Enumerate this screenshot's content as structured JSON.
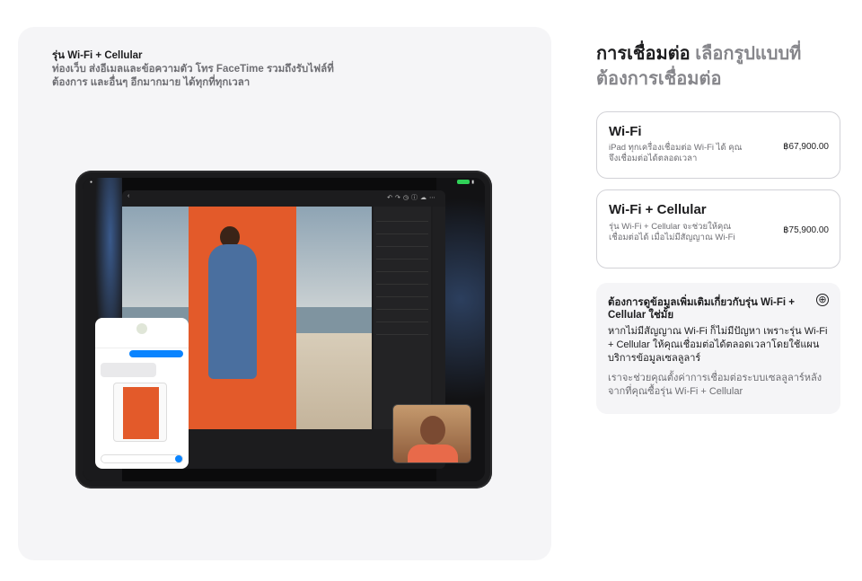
{
  "gallery": {
    "caption_title": "รุ่น Wi-Fi + Cellular",
    "caption_body": "ท่องเว็บ ส่งอีเมลและข้อความตัว โทร FaceTime รวมถึงรับไฟล์ที่ต้องการ และอื่นๆ อีกมากมาย ได้ทุกที่ทุกเวลา"
  },
  "section": {
    "heading_strong": "การเชื่อมต่อ",
    "heading_muted": "เลือกรูปแบบที่ต้องการเชื่อมต่อ"
  },
  "options": [
    {
      "title": "Wi-Fi",
      "description": "iPad ทุกเครื่องเชื่อมต่อ Wi-Fi ได้ คุณจึงเชื่อมต่อได้ตลอดเวลา",
      "price": "฿67,900.00"
    },
    {
      "title": "Wi-Fi + Cellular",
      "description": "รุ่น Wi-Fi + Cellular จะช่วยให้คุณเชื่อมต่อได้ เมื่อไม่มีสัญญาณ Wi-Fi",
      "price": "฿75,900.00"
    }
  ],
  "info": {
    "title": "ต้องการดูข้อมูลเพิ่มเติมเกี่ยวกับรุ่น Wi-Fi + Cellular ใช่มั้ย",
    "plus_icon": "⊕",
    "body": "หากไม่มีสัญญาณ Wi-Fi ก็ไม่มีปัญหา เพราะรุ่น Wi-Fi + Cellular ให้คุณเชื่อมต่อได้ตลอดเวลาโดยใช้แผนบริการข้อมูลเซลลูลาร์",
    "note": "เราจะช่วยคุณตั้งค่าการเชื่อมต่อระบบเซลลูลาร์หลังจากที่คุณซื้อรุ่น Wi-Fi + Cellular"
  },
  "icons": {
    "plus": "plus-circle-icon"
  },
  "colors": {
    "panel_bg": "#f5f5f7",
    "text_primary": "#1d1d1f",
    "text_muted": "#86868b",
    "card_border": "#d2d2d7"
  }
}
